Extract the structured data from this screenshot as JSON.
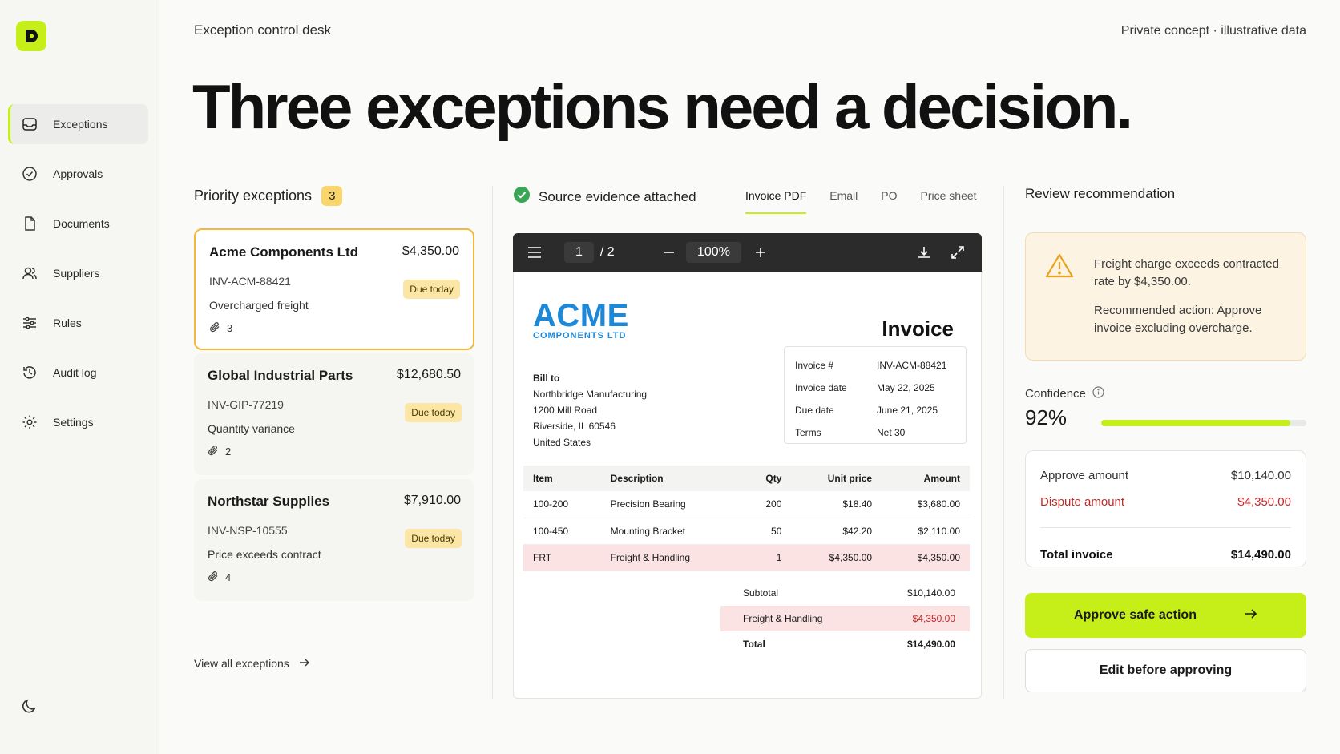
{
  "header": {
    "title": "Exception control desk",
    "note": "Private concept · illustrative data",
    "headline": "Three exceptions need a decision."
  },
  "sidebar": {
    "items": [
      {
        "label": "Exceptions",
        "icon": "inbox-icon",
        "active": true
      },
      {
        "label": "Approvals",
        "icon": "check-circle-icon"
      },
      {
        "label": "Documents",
        "icon": "document-icon"
      },
      {
        "label": "Suppliers",
        "icon": "users-icon"
      },
      {
        "label": "Rules",
        "icon": "sliders-icon"
      },
      {
        "label": "Audit log",
        "icon": "history-icon"
      },
      {
        "label": "Settings",
        "icon": "gear-icon"
      }
    ]
  },
  "exceptions": {
    "heading": "Priority exceptions",
    "count": "3",
    "cards": [
      {
        "supplier": "Acme Components Ltd",
        "amount": "$4,350.00",
        "invoice": "INV-ACM-88421",
        "reason": "Overcharged freight",
        "due": "Due today",
        "attachments": "3"
      },
      {
        "supplier": "Global Industrial Parts",
        "amount": "$12,680.50",
        "invoice": "INV-GIP-77219",
        "reason": "Quantity variance",
        "due": "Due today",
        "attachments": "2"
      },
      {
        "supplier": "Northstar Supplies",
        "amount": "$7,910.00",
        "invoice": "INV-NSP-10555",
        "reason": "Price exceeds contract",
        "due": "Due today",
        "attachments": "4"
      }
    ],
    "view_all": "View all exceptions"
  },
  "evidence": {
    "heading": "Source evidence attached",
    "tabs": [
      "Invoice PDF",
      "Email",
      "PO",
      "Price sheet"
    ],
    "toolbar": {
      "page": "1",
      "pages": "/ 2",
      "zoom": "100%"
    },
    "invoice": {
      "brand": "ACME",
      "brand_sub": "COMPONENTS LTD",
      "title": "Invoice",
      "bill_to_label": "Bill to",
      "bill_to": [
        "Northbridge Manufacturing",
        "1200 Mill Road",
        "Riverside, IL 60546",
        "United States"
      ],
      "meta": [
        {
          "k": "Invoice #",
          "v": "INV-ACM-88421"
        },
        {
          "k": "Invoice date",
          "v": "May 22, 2025"
        },
        {
          "k": "Due date",
          "v": "June 21, 2025"
        },
        {
          "k": "Terms",
          "v": "Net 30"
        }
      ],
      "columns": [
        "Item",
        "Description",
        "Qty",
        "Unit price",
        "Amount"
      ],
      "rows": [
        {
          "item": "100-200",
          "desc": "Precision Bearing",
          "qty": "200",
          "unit": "$18.40",
          "amount": "$3,680.00"
        },
        {
          "item": "100-450",
          "desc": "Mounting Bracket",
          "qty": "50",
          "unit": "$42.20",
          "amount": "$2,110.00"
        },
        {
          "item": "FRT",
          "desc": "Freight & Handling",
          "qty": "1",
          "unit": "$4,350.00",
          "amount": "$4,350.00"
        }
      ],
      "totals": [
        {
          "k": "Subtotal",
          "v": "$10,140.00"
        },
        {
          "k": "Freight & Handling",
          "v": "$4,350.00"
        },
        {
          "k": "Total",
          "v": "$14,490.00"
        }
      ]
    }
  },
  "review": {
    "heading": "Review recommendation",
    "alert_line1": "Freight charge exceeds contracted rate by $4,350.00.",
    "alert_line2": "Recommended action: Approve invoice excluding overcharge.",
    "confidence_label": "Confidence",
    "confidence_value": "92%",
    "confidence_fraction": 0.92,
    "amounts": [
      {
        "k": "Approve amount",
        "v": "$10,140.00"
      },
      {
        "k": "Dispute amount",
        "v": "$4,350.00"
      },
      {
        "k": "Total invoice",
        "v": "$14,490.00"
      }
    ],
    "primary_button": "Approve safe action",
    "secondary_button": "Edit before approving"
  },
  "colors": {
    "accent": "#c6ef1a",
    "warning": "#f4b93b",
    "danger": "#c62828",
    "brand_blue": "#1e88d8"
  }
}
